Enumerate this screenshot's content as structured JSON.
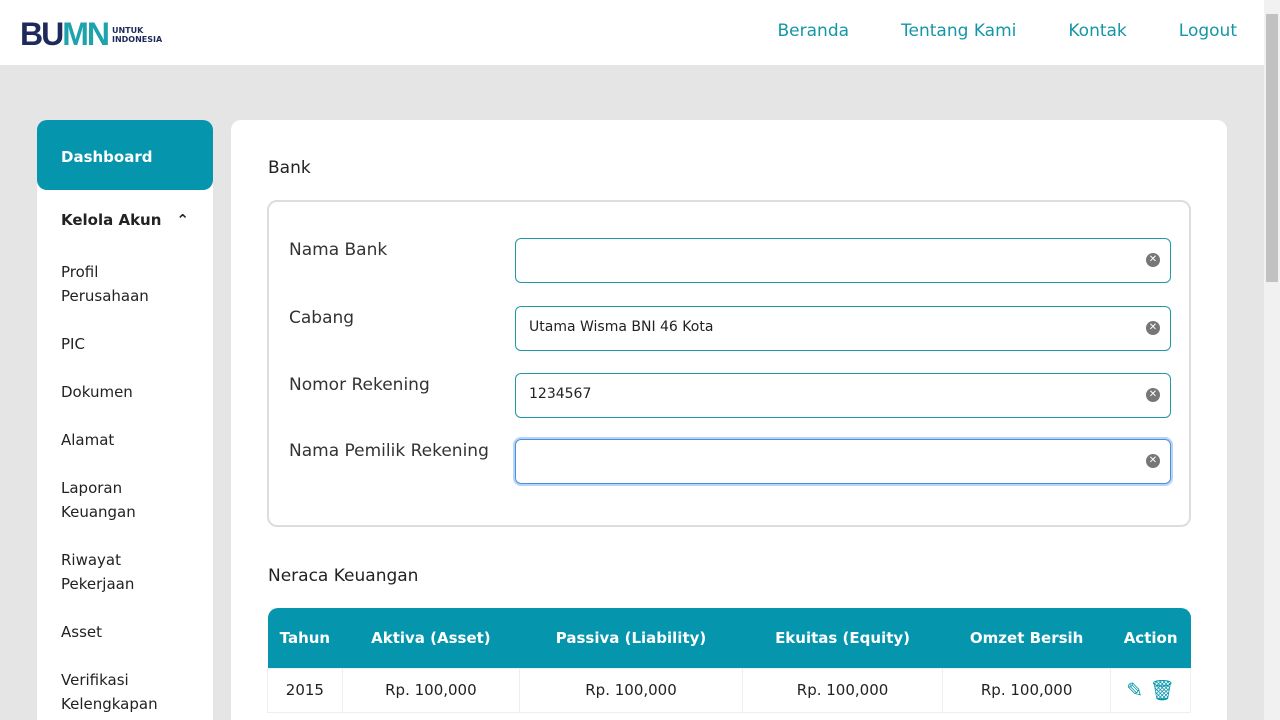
{
  "header": {
    "logo": {
      "text": "BUMN",
      "sub1": "UNTUK",
      "sub2": "INDONESIA"
    },
    "nav": [
      "Beranda",
      "Tentang Kami",
      "Kontak",
      "Logout"
    ]
  },
  "sidebar": {
    "active": "Dashboard",
    "group": "Kelola Akun",
    "items": [
      "Profil Perusahaan",
      "PIC",
      "Dokumen",
      "Alamat",
      "Laporan Keuangan",
      "Riwayat Pekerjaan",
      "Asset",
      "Verifikasi Kelengkapan"
    ]
  },
  "bank": {
    "title": "Bank",
    "fields": [
      {
        "label": "Nama Bank",
        "value": ""
      },
      {
        "label": "Cabang",
        "value": "Utama Wisma BNI 46 Kota"
      },
      {
        "label": "Nomor Rekening",
        "value": "1234567"
      },
      {
        "label": "Nama Pemilik Rekening",
        "value": ""
      }
    ]
  },
  "neraca": {
    "title": "Neraca Keuangan",
    "columns": [
      "Tahun",
      "Aktiva (Asset)",
      "Passiva (Liability)",
      "Ekuitas (Equity)",
      "Omzet Bersih",
      "Action"
    ],
    "rows": [
      [
        "2015",
        "Rp. 100,000",
        "Rp. 100,000",
        "Rp. 100,000",
        "Rp. 100,000"
      ]
    ]
  },
  "colors": {
    "accent": "#0595ad"
  }
}
